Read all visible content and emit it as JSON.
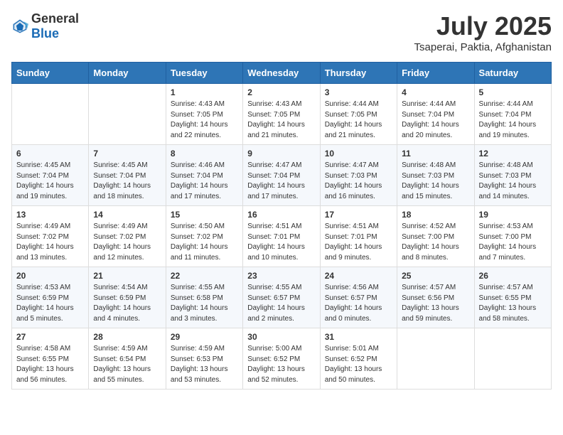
{
  "logo": {
    "general": "General",
    "blue": "Blue"
  },
  "title": "July 2025",
  "subtitle": "Tsaperai, Paktia, Afghanistan",
  "header_days": [
    "Sunday",
    "Monday",
    "Tuesday",
    "Wednesday",
    "Thursday",
    "Friday",
    "Saturday"
  ],
  "weeks": [
    [
      {
        "day": "",
        "info": ""
      },
      {
        "day": "",
        "info": ""
      },
      {
        "day": "1",
        "info": "Sunrise: 4:43 AM\nSunset: 7:05 PM\nDaylight: 14 hours and 22 minutes."
      },
      {
        "day": "2",
        "info": "Sunrise: 4:43 AM\nSunset: 7:05 PM\nDaylight: 14 hours and 21 minutes."
      },
      {
        "day": "3",
        "info": "Sunrise: 4:44 AM\nSunset: 7:05 PM\nDaylight: 14 hours and 21 minutes."
      },
      {
        "day": "4",
        "info": "Sunrise: 4:44 AM\nSunset: 7:04 PM\nDaylight: 14 hours and 20 minutes."
      },
      {
        "day": "5",
        "info": "Sunrise: 4:44 AM\nSunset: 7:04 PM\nDaylight: 14 hours and 19 minutes."
      }
    ],
    [
      {
        "day": "6",
        "info": "Sunrise: 4:45 AM\nSunset: 7:04 PM\nDaylight: 14 hours and 19 minutes."
      },
      {
        "day": "7",
        "info": "Sunrise: 4:45 AM\nSunset: 7:04 PM\nDaylight: 14 hours and 18 minutes."
      },
      {
        "day": "8",
        "info": "Sunrise: 4:46 AM\nSunset: 7:04 PM\nDaylight: 14 hours and 17 minutes."
      },
      {
        "day": "9",
        "info": "Sunrise: 4:47 AM\nSunset: 7:04 PM\nDaylight: 14 hours and 17 minutes."
      },
      {
        "day": "10",
        "info": "Sunrise: 4:47 AM\nSunset: 7:03 PM\nDaylight: 14 hours and 16 minutes."
      },
      {
        "day": "11",
        "info": "Sunrise: 4:48 AM\nSunset: 7:03 PM\nDaylight: 14 hours and 15 minutes."
      },
      {
        "day": "12",
        "info": "Sunrise: 4:48 AM\nSunset: 7:03 PM\nDaylight: 14 hours and 14 minutes."
      }
    ],
    [
      {
        "day": "13",
        "info": "Sunrise: 4:49 AM\nSunset: 7:02 PM\nDaylight: 14 hours and 13 minutes."
      },
      {
        "day": "14",
        "info": "Sunrise: 4:49 AM\nSunset: 7:02 PM\nDaylight: 14 hours and 12 minutes."
      },
      {
        "day": "15",
        "info": "Sunrise: 4:50 AM\nSunset: 7:02 PM\nDaylight: 14 hours and 11 minutes."
      },
      {
        "day": "16",
        "info": "Sunrise: 4:51 AM\nSunset: 7:01 PM\nDaylight: 14 hours and 10 minutes."
      },
      {
        "day": "17",
        "info": "Sunrise: 4:51 AM\nSunset: 7:01 PM\nDaylight: 14 hours and 9 minutes."
      },
      {
        "day": "18",
        "info": "Sunrise: 4:52 AM\nSunset: 7:00 PM\nDaylight: 14 hours and 8 minutes."
      },
      {
        "day": "19",
        "info": "Sunrise: 4:53 AM\nSunset: 7:00 PM\nDaylight: 14 hours and 7 minutes."
      }
    ],
    [
      {
        "day": "20",
        "info": "Sunrise: 4:53 AM\nSunset: 6:59 PM\nDaylight: 14 hours and 5 minutes."
      },
      {
        "day": "21",
        "info": "Sunrise: 4:54 AM\nSunset: 6:59 PM\nDaylight: 14 hours and 4 minutes."
      },
      {
        "day": "22",
        "info": "Sunrise: 4:55 AM\nSunset: 6:58 PM\nDaylight: 14 hours and 3 minutes."
      },
      {
        "day": "23",
        "info": "Sunrise: 4:55 AM\nSunset: 6:57 PM\nDaylight: 14 hours and 2 minutes."
      },
      {
        "day": "24",
        "info": "Sunrise: 4:56 AM\nSunset: 6:57 PM\nDaylight: 14 hours and 0 minutes."
      },
      {
        "day": "25",
        "info": "Sunrise: 4:57 AM\nSunset: 6:56 PM\nDaylight: 13 hours and 59 minutes."
      },
      {
        "day": "26",
        "info": "Sunrise: 4:57 AM\nSunset: 6:55 PM\nDaylight: 13 hours and 58 minutes."
      }
    ],
    [
      {
        "day": "27",
        "info": "Sunrise: 4:58 AM\nSunset: 6:55 PM\nDaylight: 13 hours and 56 minutes."
      },
      {
        "day": "28",
        "info": "Sunrise: 4:59 AM\nSunset: 6:54 PM\nDaylight: 13 hours and 55 minutes."
      },
      {
        "day": "29",
        "info": "Sunrise: 4:59 AM\nSunset: 6:53 PM\nDaylight: 13 hours and 53 minutes."
      },
      {
        "day": "30",
        "info": "Sunrise: 5:00 AM\nSunset: 6:52 PM\nDaylight: 13 hours and 52 minutes."
      },
      {
        "day": "31",
        "info": "Sunrise: 5:01 AM\nSunset: 6:52 PM\nDaylight: 13 hours and 50 minutes."
      },
      {
        "day": "",
        "info": ""
      },
      {
        "day": "",
        "info": ""
      }
    ]
  ]
}
